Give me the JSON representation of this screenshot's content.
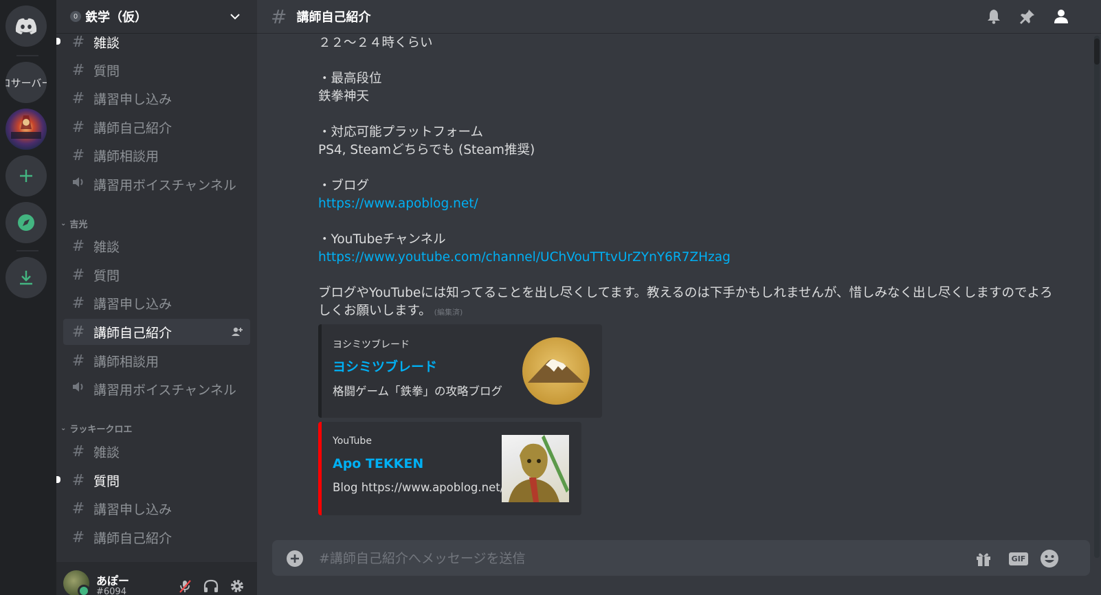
{
  "server_rail": {
    "servers": [
      {
        "icon": "discord-home-icon"
      },
      {
        "label": "ロサーバー"
      },
      {
        "icon": "server-tekken-art"
      },
      {
        "icon": "add-server-icon",
        "color": "#43b581"
      },
      {
        "icon": "explore-compass-icon",
        "color": "#43b581"
      },
      {
        "icon": "download-icon",
        "color": "#43b581"
      }
    ]
  },
  "server": {
    "badge": "0",
    "name": "鉄学（仮）"
  },
  "sidebar": {
    "section1": {
      "channels": [
        {
          "label": "雑談",
          "icon": "hash-icon",
          "unread": true
        },
        {
          "label": "質問",
          "icon": "hash-icon"
        },
        {
          "label": "講習申し込み",
          "icon": "hash-icon"
        },
        {
          "label": "講師自己紹介",
          "icon": "hash-icon"
        },
        {
          "label": "講師相談用",
          "icon": "hash-lock-icon"
        },
        {
          "label": "講習用ボイスチャンネル",
          "icon": "speaker-icon"
        }
      ]
    },
    "section2": {
      "name": "吉光",
      "channels": [
        {
          "label": "雑談",
          "icon": "hash-icon"
        },
        {
          "label": "質問",
          "icon": "hash-icon"
        },
        {
          "label": "講習申し込み",
          "icon": "hash-icon"
        },
        {
          "label": "講師自己紹介",
          "icon": "hash-icon",
          "active": true
        },
        {
          "label": "講師相談用",
          "icon": "hash-lock-icon"
        },
        {
          "label": "講習用ボイスチャンネル",
          "icon": "speaker-icon"
        }
      ]
    },
    "section3": {
      "name": "ラッキークロエ",
      "channels": [
        {
          "label": "雑談",
          "icon": "hash-icon"
        },
        {
          "label": "質問",
          "icon": "hash-icon",
          "unread": true
        },
        {
          "label": "講習申し込み",
          "icon": "hash-icon"
        },
        {
          "label": "講師自己紹介",
          "icon": "hash-icon"
        }
      ]
    }
  },
  "user": {
    "name": "あぽー",
    "tag": "#6094",
    "status_color": "#43b581"
  },
  "channel_header": {
    "title": "講師自己紹介"
  },
  "message": {
    "line_time": "２２～２４時くらい",
    "rank_heading": "・最高段位",
    "rank_value": "鉄拳神天",
    "platform_heading": "・対応可能プラットフォーム",
    "platform_value": "PS4, Steamどちらでも (Steam推奨)",
    "blog_heading": "・ブログ",
    "blog_url": "https://www.apoblog.net/",
    "youtube_heading": "・YouTubeチャンネル",
    "youtube_url": "https://www.youtube.com/channel/UChVouTTtvUrZYnY6R7ZHzag",
    "closing": "ブログやYouTubeには知ってることを出し尽くしてます。教えるのは下手かもしれませんが、惜しみなく出し尽くしますのでよろしくお願いします。",
    "edited": "(編集済)"
  },
  "embeds": [
    {
      "provider": "ヨシミツブレード",
      "title": "ヨシミツブレード",
      "description": "格闘ゲーム「鉄拳」の攻略ブログ",
      "accent": "#202225"
    },
    {
      "provider": "YouTube",
      "title": "Apo TEKKEN",
      "description": "Blog https://www.apoblog.net/",
      "accent": "#ff0000"
    }
  ],
  "composer": {
    "placeholder": "#講師自己紹介へメッセージを送信",
    "gif_label": "GIF"
  },
  "colors": {
    "link": "#00b0f4",
    "background": "#36393f",
    "sidebar": "#2f3136",
    "rail": "#202225"
  }
}
